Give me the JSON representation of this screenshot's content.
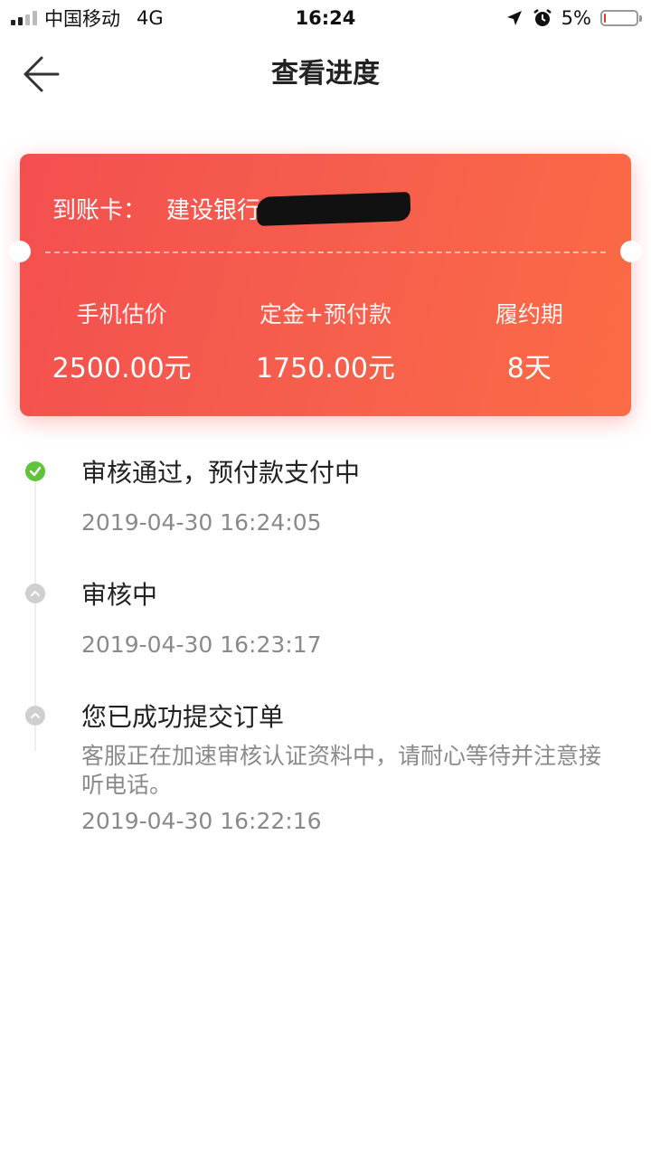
{
  "status_bar": {
    "carrier": "中国移动",
    "network": "4G",
    "time": "16:24",
    "battery_percent": "5%",
    "battery_level": 0.05,
    "battery_color": "#e8342f"
  },
  "nav": {
    "title": "查看进度",
    "back_icon": "arrow-left-icon"
  },
  "card": {
    "account_label": "到账卡：",
    "account_value": "建设银行",
    "gradient_start": "#f34f4f",
    "gradient_end": "#fb6b45",
    "stats": [
      {
        "label": "手机估价",
        "value": "2500.00元"
      },
      {
        "label": "定金+预付款",
        "value": "1750.00元"
      },
      {
        "label": "履约期",
        "value": "8天"
      }
    ]
  },
  "timeline": {
    "items": [
      {
        "title": "审核通过，预付款支付中",
        "time": "2019-04-30 16:24:05",
        "status": "done",
        "icon": "check-circle-icon",
        "color": "#5fc43a"
      },
      {
        "title": "审核中",
        "time": "2019-04-30 16:23:17",
        "status": "pending",
        "icon": "chevron-up-circle-icon",
        "color": "#cfcfcf"
      },
      {
        "title": "您已成功提交订单",
        "desc": "客服正在加速审核认证资料中，请耐心等待并注意接听电话。",
        "time": "2019-04-30 16:22:16",
        "status": "pending",
        "icon": "chevron-up-circle-icon",
        "color": "#cfcfcf"
      }
    ]
  }
}
